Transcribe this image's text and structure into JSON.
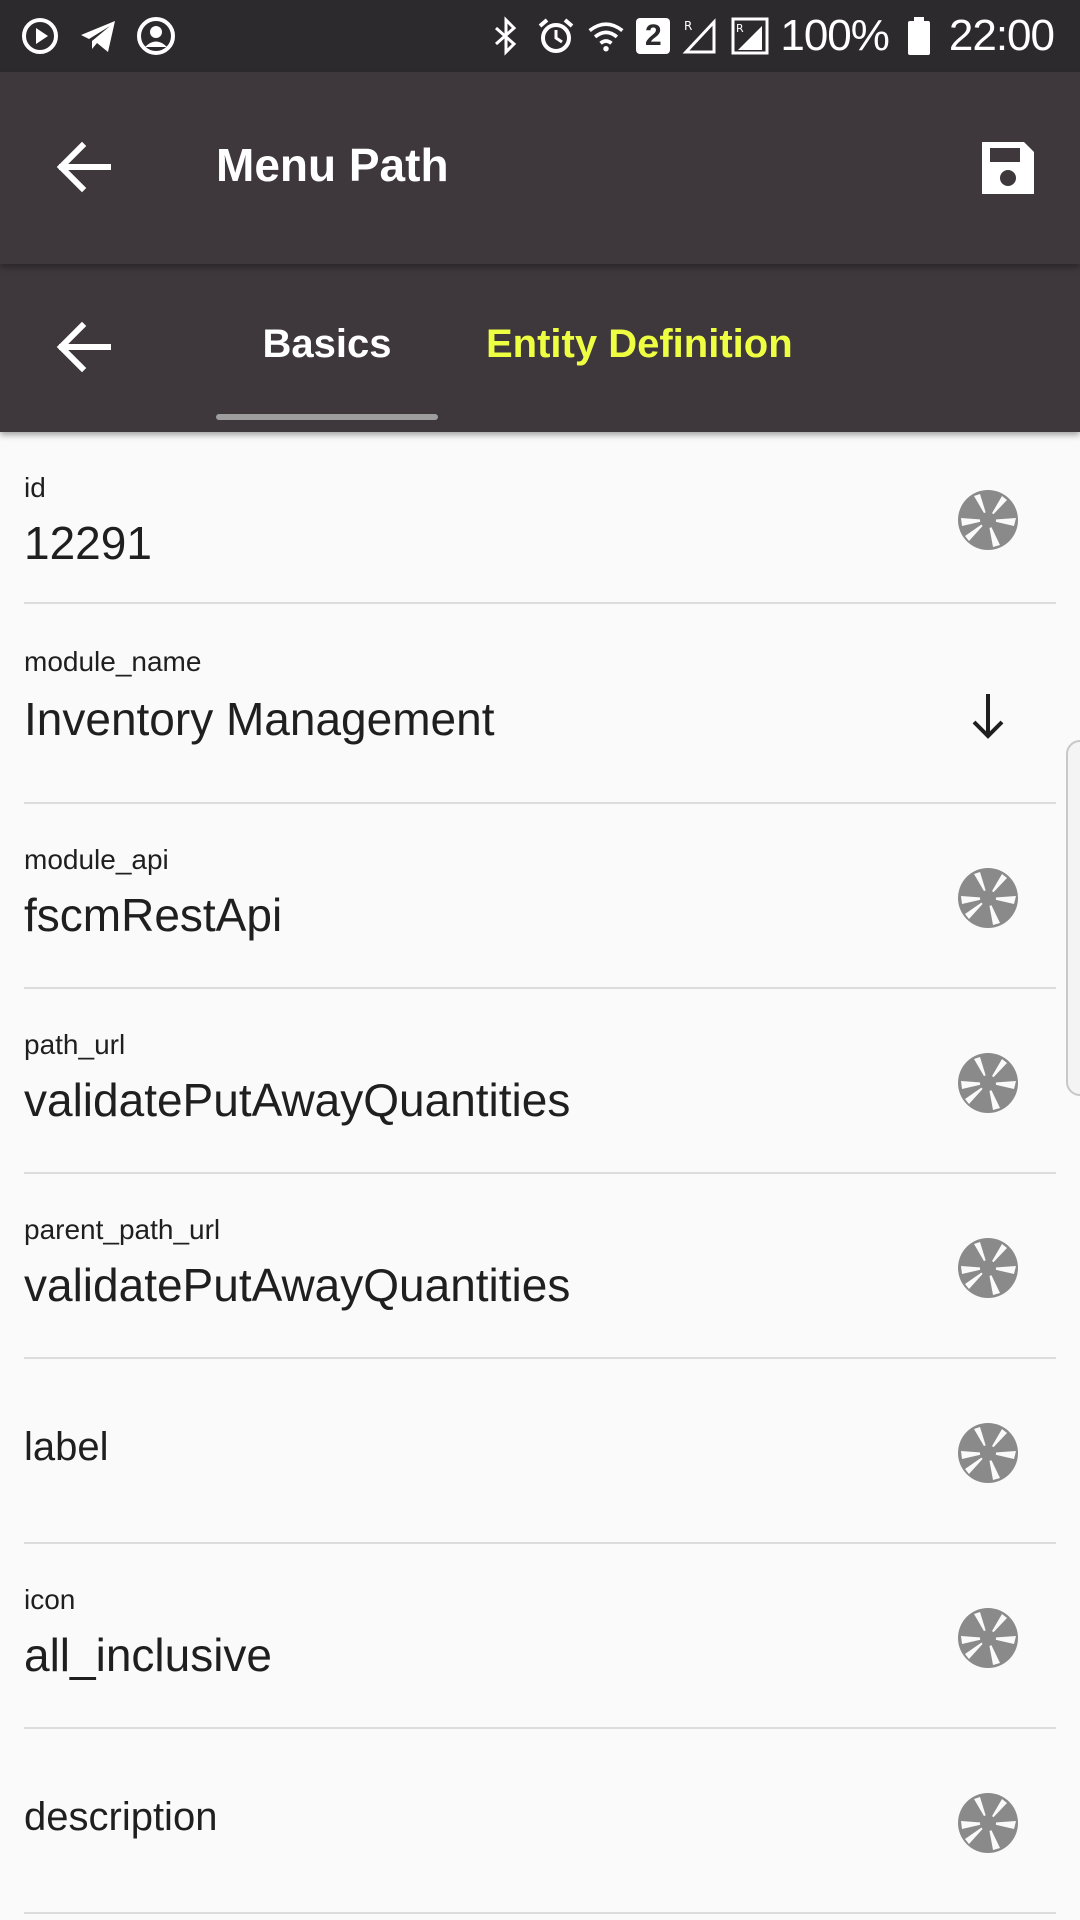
{
  "status_bar": {
    "battery": "100%",
    "time": "22:00",
    "sim_badge": "2",
    "icons": [
      "play-circle-icon",
      "telegram-icon",
      "account-circle-icon",
      "bluetooth-icon",
      "alarm-icon",
      "wifi-icon",
      "signal-icon",
      "battery-icon"
    ]
  },
  "app_bar": {
    "title": "Menu Path",
    "back_icon": "arrow-back-icon",
    "save_icon": "save-icon"
  },
  "tabs": {
    "back_icon": "arrow-back-icon",
    "items": [
      {
        "label": "Basics",
        "selected": true,
        "color": "#ffffff"
      },
      {
        "label": "Entity Definition",
        "selected": false,
        "color": "#eeff41"
      }
    ]
  },
  "fields": [
    {
      "label": "id",
      "value": "12291",
      "action_icon": "camera-shutter-icon"
    },
    {
      "label": "module_name",
      "value": "Inventory Management",
      "action_icon": "arrow-down-icon"
    },
    {
      "label": "module_api",
      "value": "fscmRestApi",
      "action_icon": "camera-shutter-icon"
    },
    {
      "label": "path_url",
      "value": "validatePutAwayQuantities",
      "action_icon": "camera-shutter-icon"
    },
    {
      "label": "parent_path_url",
      "value": "validatePutAwayQuantities",
      "action_icon": "camera-shutter-icon"
    },
    {
      "label": "label",
      "value": "",
      "action_icon": "camera-shutter-icon"
    },
    {
      "label": "icon",
      "value": "all_inclusive",
      "action_icon": "camera-shutter-icon"
    },
    {
      "label": "description",
      "value": "",
      "action_icon": "camera-shutter-icon"
    }
  ],
  "colors": {
    "app_bar": "#3e373c",
    "status_bar": "#2d2a2d",
    "tab_active": "#ffffff",
    "tab_inactive": "#eeff41",
    "background": "#fafafa",
    "icon_grey": "#8a8a8a"
  }
}
